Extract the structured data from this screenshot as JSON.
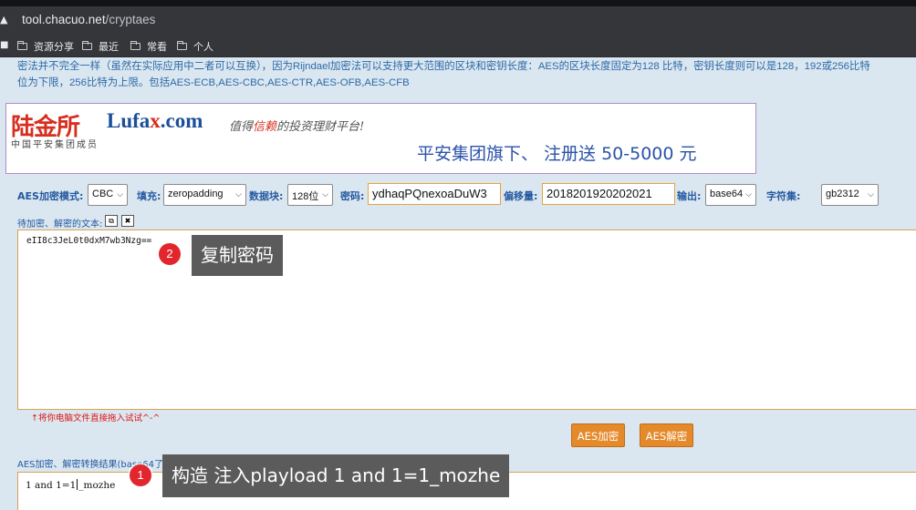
{
  "browser": {
    "url_host": "tool.chacuo.net",
    "url_path": "/cryptaes",
    "bookmarks": [
      "资源分享",
      "最近",
      "常看",
      "个人"
    ]
  },
  "intro": {
    "line1": "密法并不完全一样（虽然在实际应用中二者可以互换），因为Rijndael加密法可以支持更大范围的区块和密钥长度：AES的区块长度固定为128 比特，密钥长度则可以是128，192或256比特",
    "line2": "位为下限，256比特为上限。包括AES-ECB,AES-CBC,AES-CTR,AES-OFB,AES-CFB"
  },
  "ad": {
    "logo_cn": "陆金所",
    "logo_en_a": "Lufa",
    "logo_en_x": "x",
    "logo_en_b": ".com",
    "logo_sub": "中国平安集团成员",
    "slogan_a": "值得",
    "slogan_hl": "信赖",
    "slogan_b": "的投资理财平台!",
    "promo": "平安集团旗下、 注册送 50-5000 元"
  },
  "form": {
    "mode_label": "AES加密模式:",
    "mode_value": "CBC",
    "padding_label": "填充:",
    "padding_value": "zeropadding",
    "block_label": "数据块:",
    "block_value": "128位",
    "key_label": "密码:",
    "key_value": "ydhaqPQnexoaDuW3",
    "iv_label": "偏移量:",
    "iv_value": "2018201920202021",
    "output_label": "输出:",
    "output_value": "base64",
    "charset_label": "字符集:",
    "charset_value": "gb2312"
  },
  "input_area": {
    "label": "待加密、解密的文本:",
    "value": "eII8c3JeL0t0dxM7wb3Nzg==",
    "hint": "↑将你电脑文件直接拖入试试^-^"
  },
  "buttons": {
    "encrypt": "AES加密",
    "decrypt": "AES解密"
  },
  "output_area": {
    "label": "AES加密、解密转换结果(base64了",
    "value_before_caret": "1 and 1=1",
    "value_after_caret": "_mozhe"
  },
  "annotations": {
    "badge2": "2",
    "tip2": "复制密码",
    "badge1": "1",
    "tip1": "构造 注入playload 1 and 1=1_mozhe"
  },
  "colors": {
    "accent_orange": "#e58a2b",
    "label_blue": "#2559a0",
    "badge_red": "#e2262e"
  }
}
